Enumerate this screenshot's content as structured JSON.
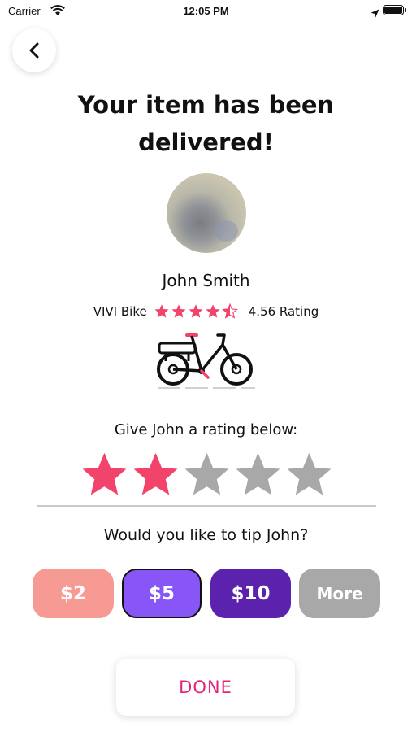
{
  "status_bar": {
    "carrier": "Carrier",
    "time": "12:05 PM"
  },
  "header": {
    "back_icon": "chevron-left-icon",
    "title": "Your item has been delivered!"
  },
  "courier": {
    "name": "John Smith",
    "vehicle": "VIVI Bike",
    "rating_value": 4.56,
    "rating_text": "4.56 Rating",
    "vehicle_icon": "bicycle-icon"
  },
  "rating": {
    "prompt": "Give John a rating below:",
    "selected": 2,
    "max": 5
  },
  "tip": {
    "prompt": "Would you like to tip John?",
    "options": [
      {
        "label": "$2",
        "color": "#f79a93"
      },
      {
        "label": "$5",
        "color": "#8856f6",
        "selected": true
      },
      {
        "label": "$10",
        "color": "#5a22ad"
      },
      {
        "label": "More",
        "color": "#a8a8a8"
      }
    ]
  },
  "done_label": "DONE",
  "colors": {
    "accent_pink": "#f2436a",
    "star_empty": "#a8a8a8",
    "done_text": "#e0267a"
  }
}
